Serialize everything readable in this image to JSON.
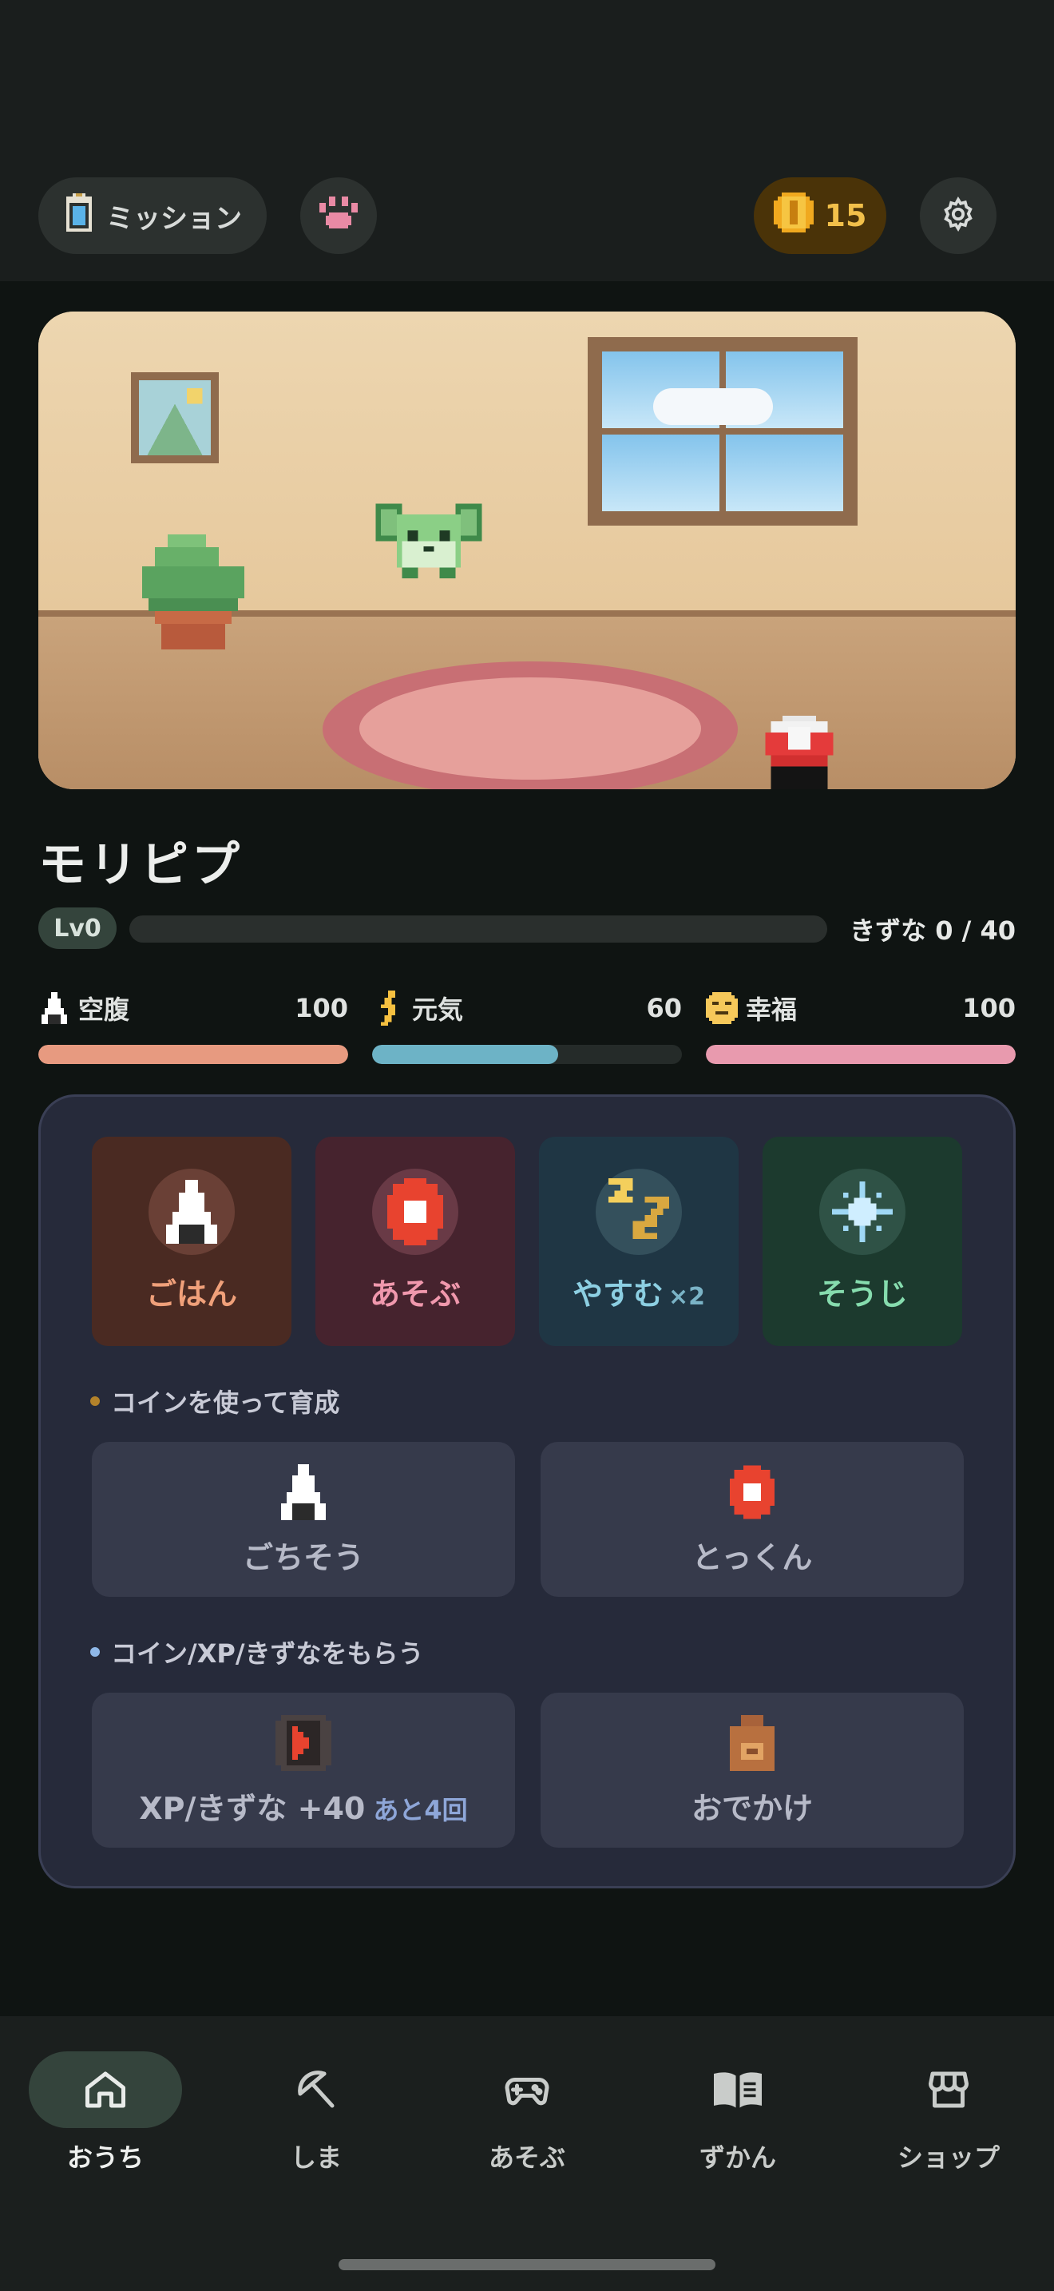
{
  "header": {
    "mission_label": "ミッション",
    "coins": "15"
  },
  "pet": {
    "name": "モリピプ",
    "level": "Lv0",
    "bond_text": "きずな 0 / 40",
    "bond_progress": 0
  },
  "stats": [
    {
      "label": "空腹",
      "value": "100",
      "fraction": 1.0,
      "color": "#e79a80"
    },
    {
      "label": "元気",
      "value": "60",
      "fraction": 0.6,
      "color": "#6db3c6"
    },
    {
      "label": "幸福",
      "value": "100",
      "fraction": 1.0,
      "color": "#e89aae"
    }
  ],
  "actions": [
    {
      "label": "ごはん",
      "extra": ""
    },
    {
      "label": "あそぶ",
      "extra": ""
    },
    {
      "label": "やすむ",
      "extra": "×2"
    },
    {
      "label": "そうじ",
      "extra": ""
    }
  ],
  "sections": {
    "coin_training": "コインを使って育成",
    "earn": "コイン/XP/きずなをもらう"
  },
  "cards": {
    "feast": "ごちそう",
    "training": "とっくん",
    "xp_bond": "XP/きずな +40",
    "xp_bond_remaining": "あと4回",
    "outing": "おでかけ"
  },
  "nav": [
    {
      "label": "おうち",
      "icon": "home-icon",
      "active": true
    },
    {
      "label": "しま",
      "icon": "island-icon",
      "active": false
    },
    {
      "label": "あそぶ",
      "icon": "gamepad-icon",
      "active": false
    },
    {
      "label": "ずかん",
      "icon": "book-icon",
      "active": false
    },
    {
      "label": "ショップ",
      "icon": "store-icon",
      "active": false
    }
  ],
  "colors": {
    "accent_green": "#34443c",
    "coin_gold": "#f2c04a",
    "panel": "#262a3a"
  }
}
